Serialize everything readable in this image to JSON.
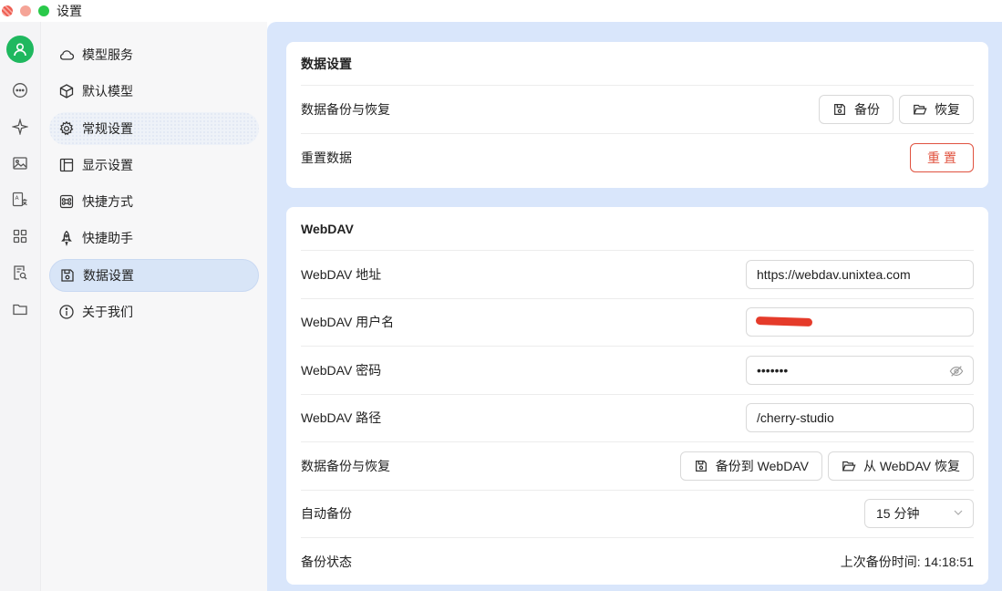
{
  "window": {
    "title": "设置"
  },
  "rail": {
    "items": [
      "avatar-icon",
      "chat-icon",
      "sparkle-icon",
      "image-icon",
      "translate-icon",
      "apps-icon",
      "document-search-icon",
      "folder-icon"
    ]
  },
  "menu": {
    "items": [
      {
        "label": "模型服务",
        "icon": "cloud-icon"
      },
      {
        "label": "默认模型",
        "icon": "cube-icon"
      },
      {
        "label": "常规设置",
        "icon": "gear-icon"
      },
      {
        "label": "显示设置",
        "icon": "layout-icon"
      },
      {
        "label": "快捷方式",
        "icon": "command-icon"
      },
      {
        "label": "快捷助手",
        "icon": "rocket-icon"
      },
      {
        "label": "数据设置",
        "icon": "save-icon"
      },
      {
        "label": "关于我们",
        "icon": "info-icon"
      }
    ],
    "active_index": 6,
    "hover_index": 2
  },
  "data_settings": {
    "title": "数据设置",
    "backup_label": "数据备份与恢复",
    "backup_button": "备份",
    "restore_button": "恢复",
    "reset_label": "重置数据",
    "reset_button": "重置"
  },
  "webdav": {
    "title": "WebDAV",
    "url_label": "WebDAV 地址",
    "url_value": "https://webdav.unixtea.com",
    "user_label": "WebDAV 用户名",
    "password_label": "WebDAV 密码",
    "password_value": "•••••••",
    "path_label": "WebDAV 路径",
    "path_value": "/cherry-studio",
    "backup_label": "数据备份与恢复",
    "backup_button": "备份到 WebDAV",
    "restore_button": "从 WebDAV 恢复",
    "auto_label": "自动备份",
    "auto_value": "15 分钟",
    "status_label": "备份状态",
    "status_value": "上次备份时间: 14:18:51"
  },
  "colors": {
    "accent_green": "#1fb85f",
    "danger": "#e0523f",
    "content_bg": "#d9e6fb",
    "active_menu": "#d8e5f7"
  }
}
